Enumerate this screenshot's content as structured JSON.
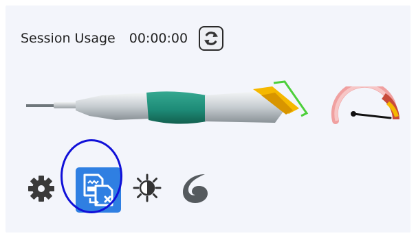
{
  "session": {
    "label": "Session Usage",
    "time": "00:00:00"
  },
  "icons": {
    "refresh": "refresh-icon",
    "handpiece": "dental-handpiece-icon",
    "gauge": "speed-gauge-icon",
    "settings": "gear-icon",
    "report": "report-files-icon",
    "brightness": "brightness-icon",
    "swirl": "swirl-icon"
  },
  "colors": {
    "panel_bg": "#f3f5fb",
    "selected_tool": "#2f7fe2",
    "highlight_ring": "#1010d8",
    "handpiece_band": "#1e8c78",
    "tip_yellow": "#f5b800",
    "tip_green": "#4ccf3a"
  }
}
